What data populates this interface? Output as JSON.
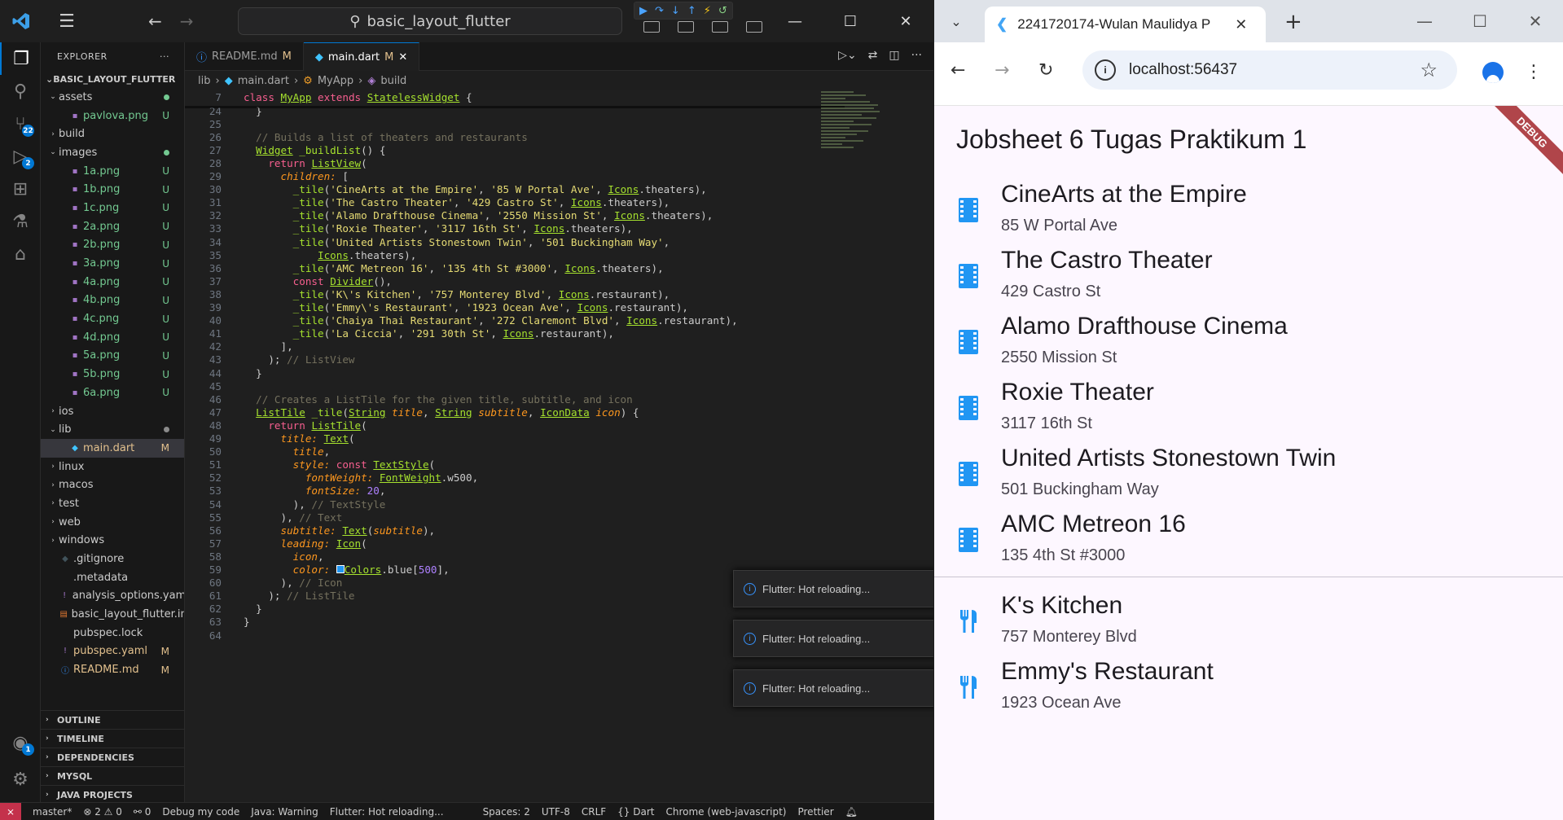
{
  "vscode": {
    "search_text": "basic_layout_flutter",
    "explorer_label": "EXPLORER",
    "project_name": "BASIC_LAYOUT_FLUTTER",
    "tree": [
      {
        "name": "assets",
        "type": "folder",
        "open": true,
        "depth": 0,
        "status": "dot"
      },
      {
        "name": "pavlova.png",
        "type": "file",
        "depth": 1,
        "status": "U"
      },
      {
        "name": "build",
        "type": "folder",
        "open": false,
        "depth": 0,
        "status": ""
      },
      {
        "name": "images",
        "type": "folder",
        "open": true,
        "depth": 0,
        "status": "dot"
      },
      {
        "name": "1a.png",
        "type": "file",
        "depth": 1,
        "status": "U"
      },
      {
        "name": "1b.png",
        "type": "file",
        "depth": 1,
        "status": "U"
      },
      {
        "name": "1c.png",
        "type": "file",
        "depth": 1,
        "status": "U"
      },
      {
        "name": "2a.png",
        "type": "file",
        "depth": 1,
        "status": "U"
      },
      {
        "name": "2b.png",
        "type": "file",
        "depth": 1,
        "status": "U"
      },
      {
        "name": "3a.png",
        "type": "file",
        "depth": 1,
        "status": "U"
      },
      {
        "name": "4a.png",
        "type": "file",
        "depth": 1,
        "status": "U"
      },
      {
        "name": "4b.png",
        "type": "file",
        "depth": 1,
        "status": "U"
      },
      {
        "name": "4c.png",
        "type": "file",
        "depth": 1,
        "status": "U"
      },
      {
        "name": "4d.png",
        "type": "file",
        "depth": 1,
        "status": "U"
      },
      {
        "name": "5a.png",
        "type": "file",
        "depth": 1,
        "status": "U"
      },
      {
        "name": "5b.png",
        "type": "file",
        "depth": 1,
        "status": "U"
      },
      {
        "name": "6a.png",
        "type": "file",
        "depth": 1,
        "status": "U"
      },
      {
        "name": "ios",
        "type": "folder",
        "open": false,
        "depth": 0,
        "status": ""
      },
      {
        "name": "lib",
        "type": "folder",
        "open": true,
        "depth": 0,
        "status": "dotgray"
      },
      {
        "name": "main.dart",
        "type": "file",
        "depth": 1,
        "status": "M",
        "selected": true
      },
      {
        "name": "linux",
        "type": "folder",
        "open": false,
        "depth": 0,
        "status": ""
      },
      {
        "name": "macos",
        "type": "folder",
        "open": false,
        "depth": 0,
        "status": ""
      },
      {
        "name": "test",
        "type": "folder",
        "open": false,
        "depth": 0,
        "status": ""
      },
      {
        "name": "web",
        "type": "folder",
        "open": false,
        "depth": 0,
        "status": ""
      },
      {
        "name": "windows",
        "type": "folder",
        "open": false,
        "depth": 0,
        "status": ""
      },
      {
        "name": ".gitignore",
        "type": "file",
        "depth": 0,
        "status": ""
      },
      {
        "name": ".metadata",
        "type": "file",
        "depth": 0,
        "status": ""
      },
      {
        "name": "analysis_options.yaml",
        "type": "file",
        "depth": 0,
        "status": ""
      },
      {
        "name": "basic_layout_flutter.iml",
        "type": "file",
        "depth": 0,
        "status": ""
      },
      {
        "name": "pubspec.lock",
        "type": "file",
        "depth": 0,
        "status": ""
      },
      {
        "name": "pubspec.yaml",
        "type": "file",
        "depth": 0,
        "status": "M"
      },
      {
        "name": "README.md",
        "type": "file",
        "depth": 0,
        "status": "M"
      }
    ],
    "sections": [
      "OUTLINE",
      "TIMELINE",
      "DEPENDENCIES",
      "MYSQL",
      "JAVA PROJECTS"
    ],
    "tabs": [
      {
        "label": "README.md",
        "status": "M",
        "active": false
      },
      {
        "label": "main.dart",
        "status": "M",
        "active": true
      }
    ],
    "breadcrumb": [
      "lib",
      "main.dart",
      "MyApp",
      "build"
    ],
    "source_control_badge": "22",
    "debug_badge": "2",
    "accounts_badge": "1",
    "code_lines": [
      {
        "n": "7",
        "html": "<span class='kw'>class</span> <span class='cls'>MyApp</span> <span class='kw'>extends</span> <span class='cls'>StatelessWidget</span> {"
      },
      {
        "n": "24",
        "html": "  }"
      },
      {
        "n": "25",
        "html": ""
      },
      {
        "n": "26",
        "html": "  <span class='com'>// Builds a list of theaters and restaurants</span>"
      },
      {
        "n": "27",
        "html": "  <span class='cls'>Widget</span> <span class='fn'>_buildList</span>() {"
      },
      {
        "n": "28",
        "html": "    <span class='kw'>return</span> <span class='cls'>ListView</span>("
      },
      {
        "n": "29",
        "html": "      <span class='prm'>children:</span> ["
      },
      {
        "n": "30",
        "html": "        <span class='fn'>_tile</span>(<span class='str'>'CineArts at the Empire'</span>, <span class='str'>'85 W Portal Ave'</span>, <span class='cls'>Icons</span>.theaters),"
      },
      {
        "n": "31",
        "html": "        <span class='fn'>_tile</span>(<span class='str'>'The Castro Theater'</span>, <span class='str'>'429 Castro St'</span>, <span class='cls'>Icons</span>.theaters),"
      },
      {
        "n": "32",
        "html": "        <span class='fn'>_tile</span>(<span class='str'>'Alamo Drafthouse Cinema'</span>, <span class='str'>'2550 Mission St'</span>, <span class='cls'>Icons</span>.theaters),"
      },
      {
        "n": "33",
        "html": "        <span class='fn'>_tile</span>(<span class='str'>'Roxie Theater'</span>, <span class='str'>'3117 16th St'</span>, <span class='cls'>Icons</span>.theaters),"
      },
      {
        "n": "34",
        "html": "        <span class='fn'>_tile</span>(<span class='str'>'United Artists Stonestown Twin'</span>, <span class='str'>'501 Buckingham Way'</span>,"
      },
      {
        "n": "35",
        "html": "            <span class='cls'>Icons</span>.theaters),"
      },
      {
        "n": "36",
        "html": "        <span class='fn'>_tile</span>(<span class='str'>'AMC Metreon 16'</span>, <span class='str'>'135 4th St #3000'</span>, <span class='cls'>Icons</span>.theaters),"
      },
      {
        "n": "37",
        "html": "        <span class='kw'>const</span> <span class='cls'>Divider</span>(),"
      },
      {
        "n": "38",
        "html": "        <span class='fn'>_tile</span>(<span class='str'>'K\\'s Kitchen'</span>, <span class='str'>'757 Monterey Blvd'</span>, <span class='cls'>Icons</span>.restaurant),"
      },
      {
        "n": "39",
        "html": "        <span class='fn'>_tile</span>(<span class='str'>'Emmy\\'s Restaurant'</span>, <span class='str'>'1923 Ocean Ave'</span>, <span class='cls'>Icons</span>.restaurant),"
      },
      {
        "n": "40",
        "html": "        <span class='fn'>_tile</span>(<span class='str'>'Chaiya Thai Restaurant'</span>, <span class='str'>'272 Claremont Blvd'</span>, <span class='cls'>Icons</span>.restaurant),"
      },
      {
        "n": "41",
        "html": "        <span class='fn'>_tile</span>(<span class='str'>'La Ciccia'</span>, <span class='str'>'291 30th St'</span>, <span class='cls'>Icons</span>.restaurant),"
      },
      {
        "n": "42",
        "html": "      ],"
      },
      {
        "n": "43",
        "html": "    ); <span class='com'>// ListView</span>"
      },
      {
        "n": "44",
        "html": "  }"
      },
      {
        "n": "45",
        "html": ""
      },
      {
        "n": "46",
        "html": "  <span class='com'>// Creates a ListTile for the given title, subtitle, and icon</span>"
      },
      {
        "n": "47",
        "html": "  <span class='cls'>ListTile</span> <span class='fn'>_tile</span>(<span class='cls'>String</span> <span class='prm'>title</span>, <span class='cls'>String</span> <span class='prm'>subtitle</span>, <span class='cls'>IconData</span> <span class='prm'>icon</span>) {"
      },
      {
        "n": "48",
        "html": "    <span class='kw'>return</span> <span class='cls'>ListTile</span>("
      },
      {
        "n": "49",
        "html": "      <span class='prm'>title:</span> <span class='cls'>Text</span>("
      },
      {
        "n": "50",
        "html": "        <span class='prm'>title</span>,"
      },
      {
        "n": "51",
        "html": "        <span class='prm'>style:</span> <span class='kw'>const</span> <span class='cls'>TextStyle</span>("
      },
      {
        "n": "52",
        "html": "          <span class='prm'>fontWeight:</span> <span class='cls'>FontWeight</span>.w500,"
      },
      {
        "n": "53",
        "html": "          <span class='prm'>fontSize:</span> <span class='num'>20</span>,"
      },
      {
        "n": "54",
        "html": "        ), <span class='com'>// TextStyle</span>"
      },
      {
        "n": "55",
        "html": "      ), <span class='com'>// Text</span>"
      },
      {
        "n": "56",
        "html": "      <span class='prm'>subtitle:</span> <span class='cls'>Text</span>(<span class='prm'>subtitle</span>),"
      },
      {
        "n": "57",
        "html": "      <span class='prm'>leading:</span> <span class='cls'>Icon</span>("
      },
      {
        "n": "58",
        "html": "        <span class='prm'>icon</span>,"
      },
      {
        "n": "59",
        "html": "        <span class='prm'>color:</span> <span style='display:inline-block;width:10px;height:10px;background:#2196f3;border:1px solid #fff'></span><span class='cls'>Colors</span>.blue[<span class='num'>500</span>],"
      },
      {
        "n": "60",
        "html": "      ), <span class='com'>// Icon</span>"
      },
      {
        "n": "61",
        "html": "    ); <span class='com'>// ListTile</span>"
      },
      {
        "n": "62",
        "html": "  }"
      },
      {
        "n": "63",
        "html": "}"
      },
      {
        "n": "64",
        "html": ""
      }
    ],
    "toasts": [
      "Flutter: Hot reloading...",
      "Flutter: Hot reloading...",
      "Flutter: Hot reloading..."
    ],
    "status": {
      "branch": "master*",
      "problems": "⊗ 2 ⚠ 0",
      "ports": "⚯ 0",
      "debug": "Debug my code",
      "java": "Java: Warning",
      "flutter": "Flutter: Hot reloading...",
      "spaces": "Spaces: 2",
      "encoding": "UTF-8",
      "eol": "CRLF",
      "language": "{} Dart",
      "device": "Chrome (web-javascript)",
      "prettier": "Prettier"
    }
  },
  "chrome": {
    "tab_title": "2241720174-Wulan Maulidya P",
    "url": "localhost:56437",
    "app": {
      "title": "Jobsheet 6 Tugas Praktikum 1",
      "debug_banner": "DEBUG",
      "theaters": [
        {
          "title": "CineArts at the Empire",
          "subtitle": "85 W Portal Ave"
        },
        {
          "title": "The Castro Theater",
          "subtitle": "429 Castro St"
        },
        {
          "title": "Alamo Drafthouse Cinema",
          "subtitle": "2550 Mission St"
        },
        {
          "title": "Roxie Theater",
          "subtitle": "3117 16th St"
        },
        {
          "title": "United Artists Stonestown Twin",
          "subtitle": "501 Buckingham Way"
        },
        {
          "title": "AMC Metreon 16",
          "subtitle": "135 4th St #3000"
        }
      ],
      "restaurants": [
        {
          "title": "K's Kitchen",
          "subtitle": "757 Monterey Blvd"
        },
        {
          "title": "Emmy's Restaurant",
          "subtitle": "1923 Ocean Ave"
        }
      ],
      "icon_color": "#2196F3"
    }
  }
}
